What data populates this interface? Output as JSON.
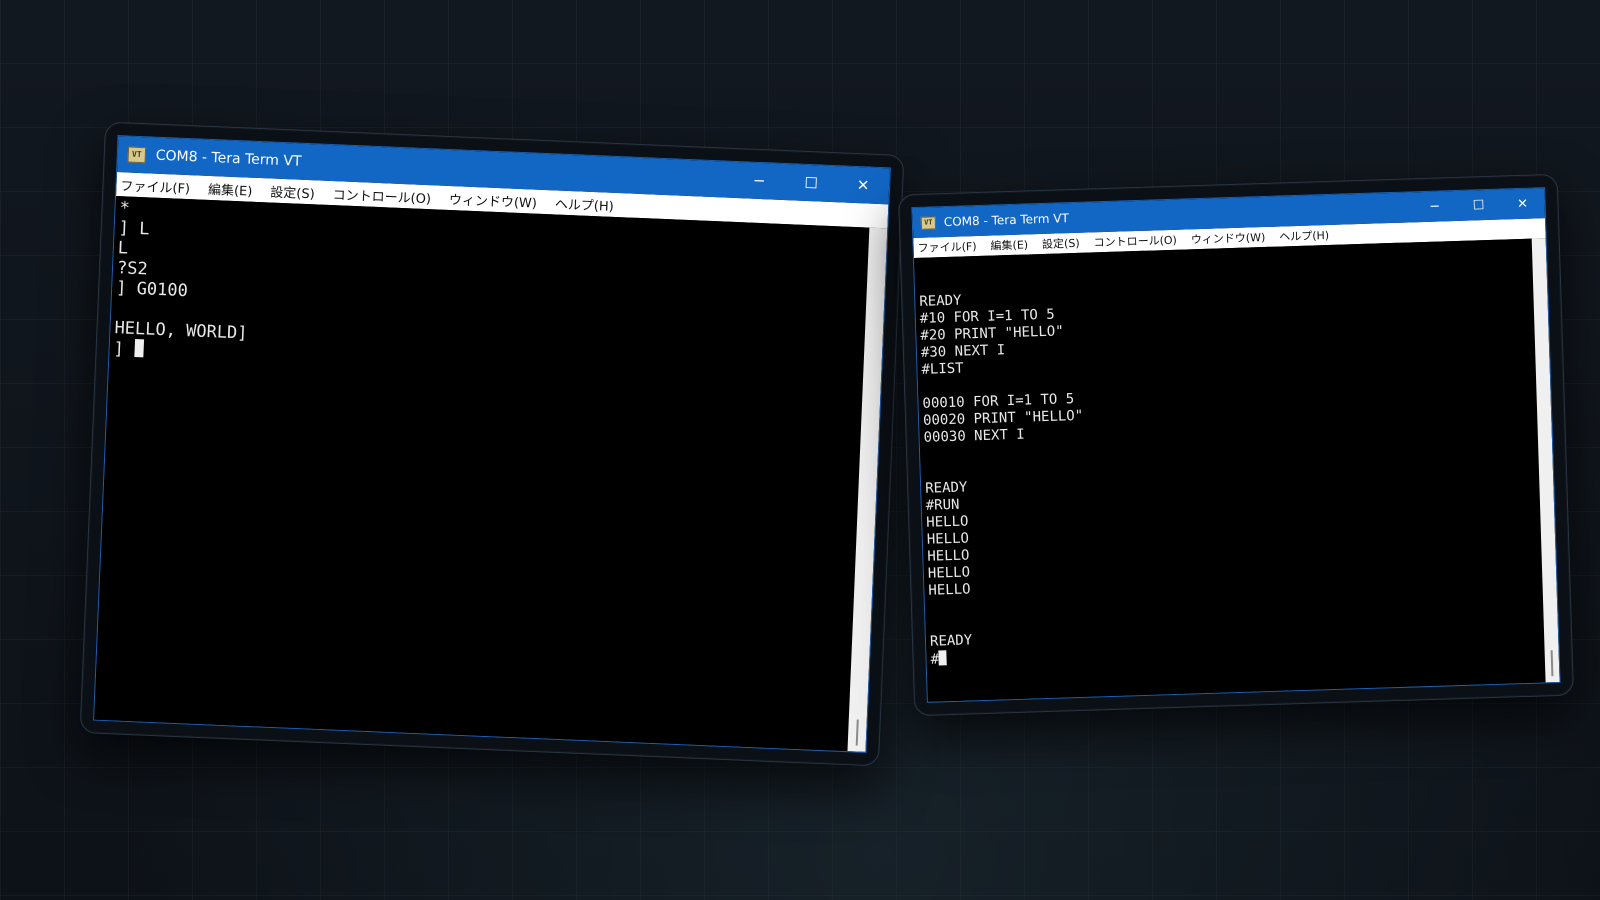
{
  "windows": [
    {
      "title": "COM8 - Tera Term VT",
      "icon": "VT",
      "controls": {
        "minimize": "─",
        "maximize": "☐",
        "close": "✕"
      },
      "menu": [
        "ファイル(F)",
        "編集(E)",
        "設定(S)",
        "コントロール(O)",
        "ウィンドウ(W)",
        "ヘルプ(H)"
      ],
      "lines": [
        "*",
        "] L",
        "L",
        "?S2",
        "] G0100",
        "",
        "HELLO, WORLD]",
        "]"
      ]
    },
    {
      "title": "COM8 - Tera Term VT",
      "icon": "VT",
      "controls": {
        "minimize": "─",
        "maximize": "☐",
        "close": "✕"
      },
      "menu": [
        "ファイル(F)",
        "編集(E)",
        "設定(S)",
        "コントロール(O)",
        "ウィンドウ(W)",
        "ヘルプ(H)"
      ],
      "lines": [
        "",
        "",
        "READY",
        "#10 FOR I=1 TO 5",
        "#20 PRINT \"HELLO\"",
        "#30 NEXT I",
        "#LIST",
        "",
        "00010 FOR I=1 TO 5",
        "00020 PRINT \"HELLO\"",
        "00030 NEXT I",
        "",
        "",
        "READY",
        "#RUN",
        "HELLO",
        "HELLO",
        "HELLO",
        "HELLO",
        "HELLO",
        "",
        "",
        "READY",
        "#"
      ]
    }
  ]
}
